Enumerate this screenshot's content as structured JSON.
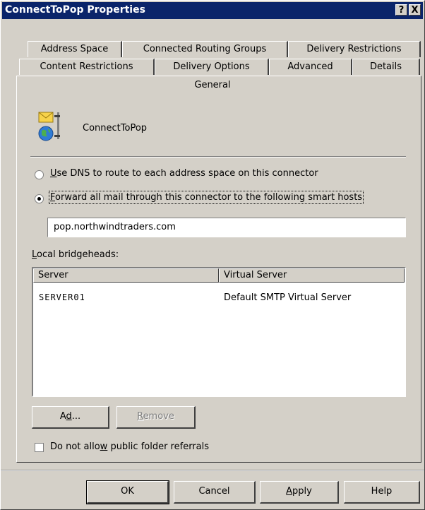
{
  "window": {
    "title": "ConnectToPop Properties",
    "help_button": "?",
    "close_button": "X"
  },
  "tabs": {
    "row1": [
      "Address Space",
      "Connected Routing Groups",
      "Delivery Restrictions"
    ],
    "row2": [
      "Content Restrictions",
      "Delivery Options",
      "Advanced",
      "Details"
    ],
    "active": "General"
  },
  "general": {
    "connector_icon": "connector-globe-envelope-icon",
    "connector_name": "ConnectToPop",
    "routing": {
      "dns_option": {
        "accel": "U",
        "rest": "se DNS to route to each address space on this connector",
        "checked": false
      },
      "smarthost_option": {
        "accel": "F",
        "rest": "orward all mail through this connector to the following smart hosts",
        "checked": true
      }
    },
    "smart_host_value": "pop.northwindtraders.com",
    "bridgeheads_label": {
      "accel": "L",
      "rest": "ocal bridgeheads:"
    },
    "bridgeheads_table": {
      "columns": [
        "Server",
        "Virtual Server"
      ],
      "rows": [
        [
          "SERVER01",
          "Default SMTP Virtual Server"
        ]
      ]
    },
    "add_button": {
      "pre": "A",
      "accel": "d",
      "post": "d..."
    },
    "remove_button": {
      "accel": "R",
      "rest": "emove",
      "enabled": false
    },
    "referrals_checkbox": {
      "pre": "Do not allo",
      "accel": "w",
      "post": " public folder referrals",
      "checked": false
    }
  },
  "footer": {
    "ok": "OK",
    "cancel": "Cancel",
    "apply": {
      "accel": "A",
      "rest": "pply"
    },
    "help": "Help"
  }
}
